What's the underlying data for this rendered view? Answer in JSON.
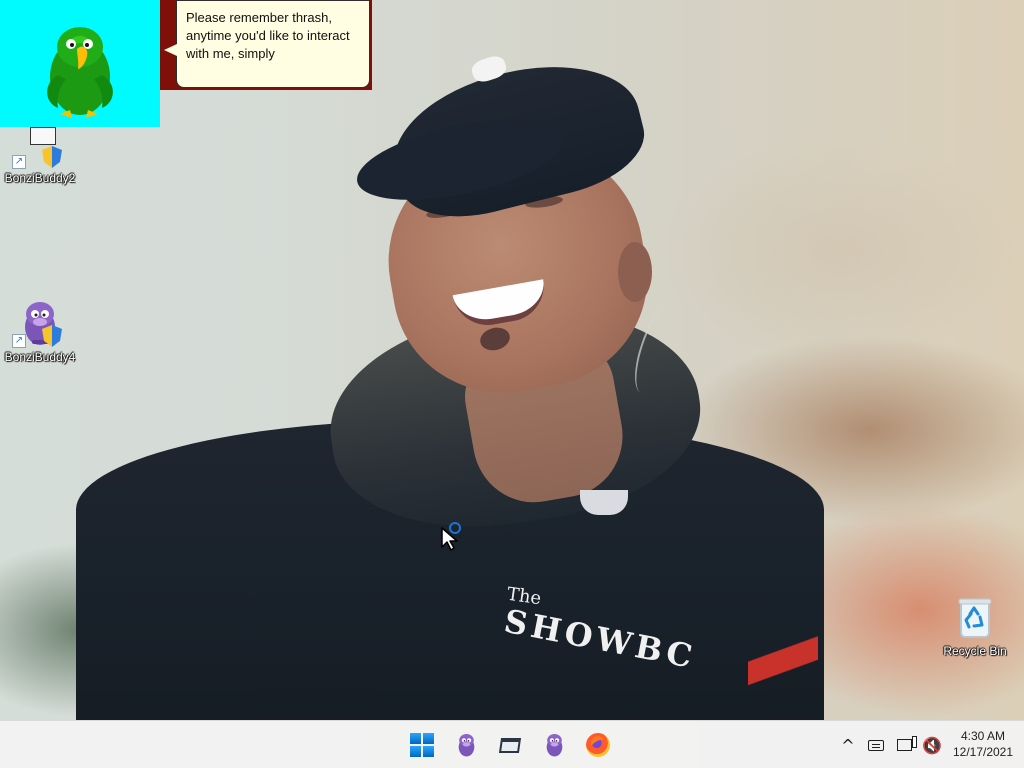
{
  "desktop": {
    "wallpaper": "wallpaper-photo",
    "shirt_text": {
      "the": "The",
      "main": "SHOWBC"
    },
    "icons": [
      {
        "label": "BonziBuddy2",
        "icon": "bonzi-parrot-shortcut-icon"
      },
      {
        "label": "BonziBuddy4",
        "icon": "bonzi-purple-shortcut-icon"
      },
      {
        "label": "Recycle Bin",
        "icon": "recycle-bin-icon"
      }
    ]
  },
  "agent": {
    "name_icon": "green-parrot-icon",
    "background_color": "#00fbff",
    "speech": "Please remember thrash, anytime you'd like to interact with me, simply"
  },
  "taskbar": {
    "apps": [
      {
        "name": "Start",
        "icon": "windows-start-icon"
      },
      {
        "name": "BonziBuddy",
        "icon": "bonzi-purple-icon"
      },
      {
        "name": "File Explorer",
        "icon": "folder-icon"
      },
      {
        "name": "BonziBuddy",
        "icon": "bonzi-purple-icon"
      },
      {
        "name": "Firefox",
        "icon": "firefox-icon"
      }
    ],
    "tray": {
      "chevron": "^",
      "time": "4:30 AM",
      "date": "12/17/2021"
    }
  },
  "cursor": {
    "icon": "pointer-busy-icon"
  },
  "colors": {
    "taskbar": "#f3f3f3",
    "accent_blue": "#0067c0",
    "bubble": "#fffee2",
    "bubble_backdrop": "#7e1009"
  }
}
